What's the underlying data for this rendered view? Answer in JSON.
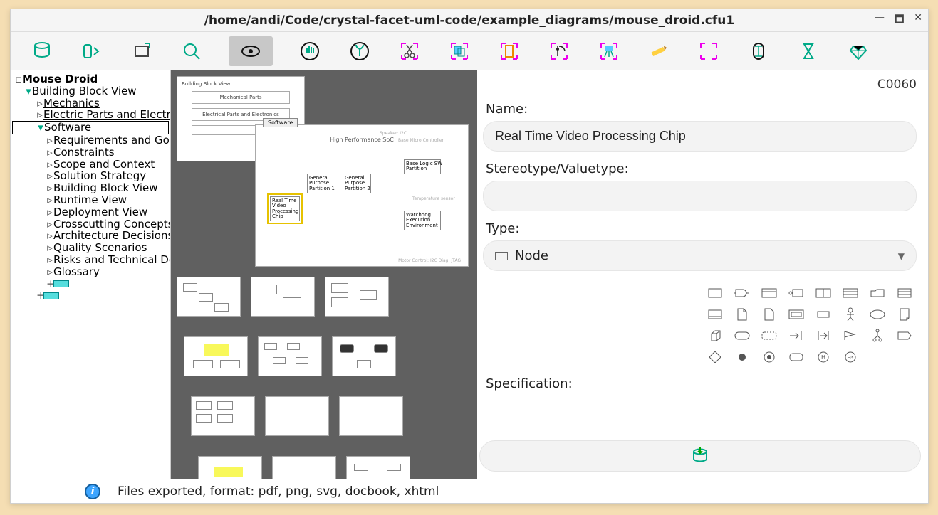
{
  "window": {
    "title": "/home/andi/Code/crystal-facet-uml-code/example_diagrams/mouse_droid.cfu1",
    "controls": {
      "min": "—",
      "max": "🗖",
      "close": "✕"
    }
  },
  "toolbar_icons": [
    "database",
    "import-export",
    "new-doc",
    "zoom",
    "eye",
    "hand",
    "sprout",
    "cut",
    "copy",
    "rotate",
    "reaper",
    "paint",
    "pencil",
    "expand",
    "hourglass-out",
    "hourglass-in",
    "gem"
  ],
  "tree": {
    "root": "Mouse Droid",
    "building_block_view": "Building Block View",
    "mechanics": "Mechanics",
    "electric": "Electric Parts and Electronics",
    "software": "Software",
    "software_children": [
      "Requirements and Goals",
      "Constraints",
      "Scope and Context",
      "Solution Strategy",
      "Building Block View",
      "Runtime View",
      "Deployment View",
      "Crosscutting Concepts",
      "Architecture Decisions",
      "Quality Scenarios",
      "Risks and Technical Debts",
      "Glossary"
    ]
  },
  "canvas": {
    "stack_title": "Building Block View",
    "stack_sub1": "Mechanical Parts",
    "stack_sub2": "Electrical Parts and Electronics",
    "main_tab": "Software",
    "main_title": "High Performance SoC",
    "nodes": {
      "rtvp": "Real Time\nVideo\nProcessing\nChip",
      "gpp1": "General\nPurpose\nPartition 1",
      "gpp2": "General\nPurpose\nPartition 2",
      "blsw": "Base Logic SW\nPartition",
      "wdog": "Watchdog\nExecution\nEnvironment"
    },
    "side_labels": {
      "speaker": "Speaker: I2C",
      "bmc": "Base Micro Controller",
      "bottom": "Motor Control: I2C Diag: JTAG",
      "temp": "Temperature sensor"
    }
  },
  "props": {
    "id": "C0060",
    "name_label": "Name:",
    "name_value": "Real Time Video Processing Chip",
    "stereo_label": "Stereotype/Valuetype:",
    "stereo_value": "",
    "type_label": "Type:",
    "type_value": "Node",
    "spec_label": "Specification:",
    "spec_value": ""
  },
  "status": "Files exported, format: pdf, png, svg, docbook, xhtml"
}
